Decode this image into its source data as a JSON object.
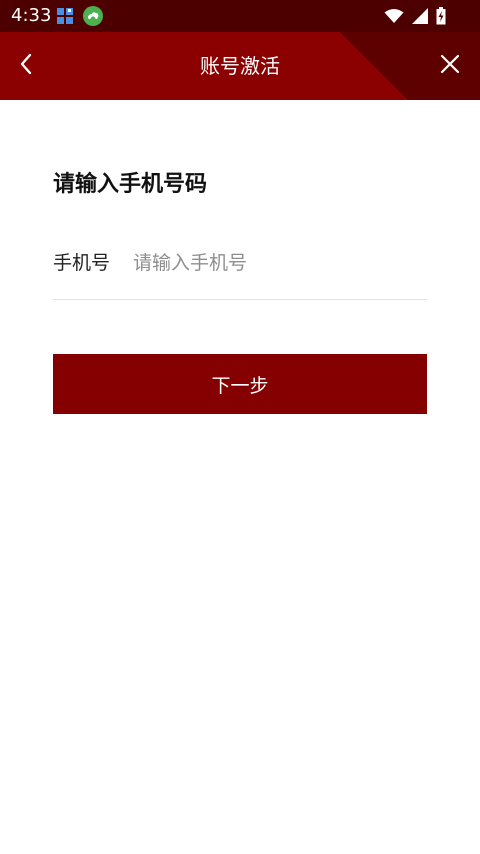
{
  "status_bar": {
    "time": "4:33",
    "left_icons": [
      "windows-app-icon",
      "cloud-sync-icon"
    ],
    "right_icons": [
      "wifi-icon",
      "cell-signal-icon",
      "battery-charging-icon"
    ]
  },
  "app_bar": {
    "title": "账号激活",
    "back_icon": "chevron-left-icon",
    "close_icon": "close-icon"
  },
  "form": {
    "heading": "请输入手机号码",
    "phone_label": "手机号",
    "phone_placeholder": "请输入手机号",
    "phone_value": "",
    "next_button_label": "下一步"
  },
  "colors": {
    "status_bar_bg": "#4d0000",
    "app_bar_bg": "#8b0000",
    "button_bg": "#850000",
    "text_primary": "#111111",
    "placeholder": "#8e8e8e"
  }
}
